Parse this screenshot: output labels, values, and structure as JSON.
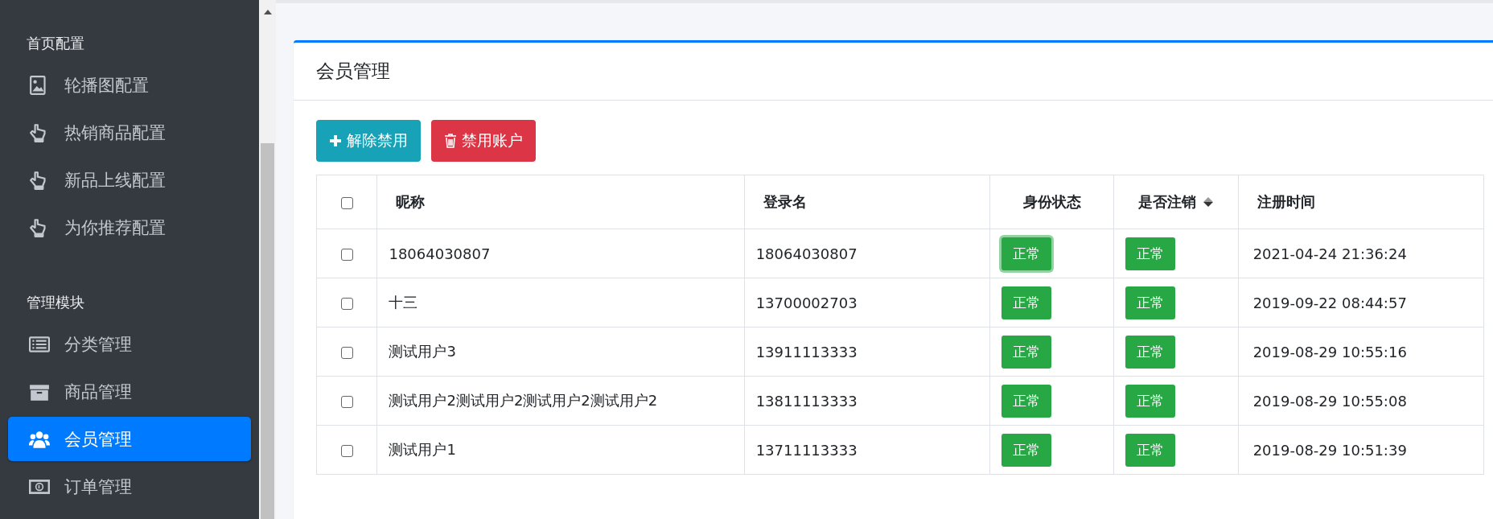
{
  "sidebar": {
    "sections": [
      {
        "label": "首页配置",
        "items": [
          {
            "label": "轮播图配置",
            "selected": false
          },
          {
            "label": "热销商品配置",
            "selected": false
          },
          {
            "label": "新品上线配置",
            "selected": false
          },
          {
            "label": "为你推荐配置",
            "selected": false
          }
        ]
      },
      {
        "label": "管理模块",
        "items": [
          {
            "label": "分类管理",
            "selected": false
          },
          {
            "label": "商品管理",
            "selected": false
          },
          {
            "label": "会员管理",
            "selected": true
          },
          {
            "label": "订单管理",
            "selected": false
          }
        ]
      }
    ]
  },
  "card": {
    "title": "会员管理",
    "buttons": [
      {
        "label": "解除禁用",
        "kind": "unban"
      },
      {
        "label": "禁用账户",
        "kind": "ban"
      }
    ],
    "table": {
      "select_all": {
        "checked": false
      },
      "columns": [
        {
          "label": "昵称",
          "sortable": false
        },
        {
          "label": "登录名",
          "sortable": false
        },
        {
          "label": "身份状态",
          "sortable": false
        },
        {
          "label": "是否注销",
          "sortable": true
        },
        {
          "label": "注册时间",
          "sortable": false
        }
      ],
      "rows": [
        {
          "checked": false,
          "nickname": "18064030807",
          "login": "18064030807",
          "status": {
            "label": "正常",
            "focused": true
          },
          "cancelled": "正常",
          "registered": "2021-04-24 21:36:24"
        },
        {
          "checked": false,
          "nickname": "十三",
          "login": "13700002703",
          "status": {
            "label": "正常",
            "focused": false
          },
          "cancelled": "正常",
          "registered": "2019-09-22 08:44:57"
        },
        {
          "checked": false,
          "nickname": "测试用户3",
          "login": "13911113333",
          "status": {
            "label": "正常",
            "focused": false
          },
          "cancelled": "正常",
          "registered": "2019-08-29 10:55:16"
        },
        {
          "checked": false,
          "nickname": "测试用户2测试用户2测试用户2测试用户2",
          "login": "13811113333",
          "status": {
            "label": "正常",
            "focused": false
          },
          "cancelled": "正常",
          "registered": "2019-08-29 10:55:08"
        },
        {
          "checked": false,
          "nickname": "测试用户1",
          "login": "13711113333",
          "status": {
            "label": "正常",
            "focused": false
          },
          "cancelled": "正常",
          "registered": "2019-08-29 10:51:39"
        }
      ]
    }
  }
}
